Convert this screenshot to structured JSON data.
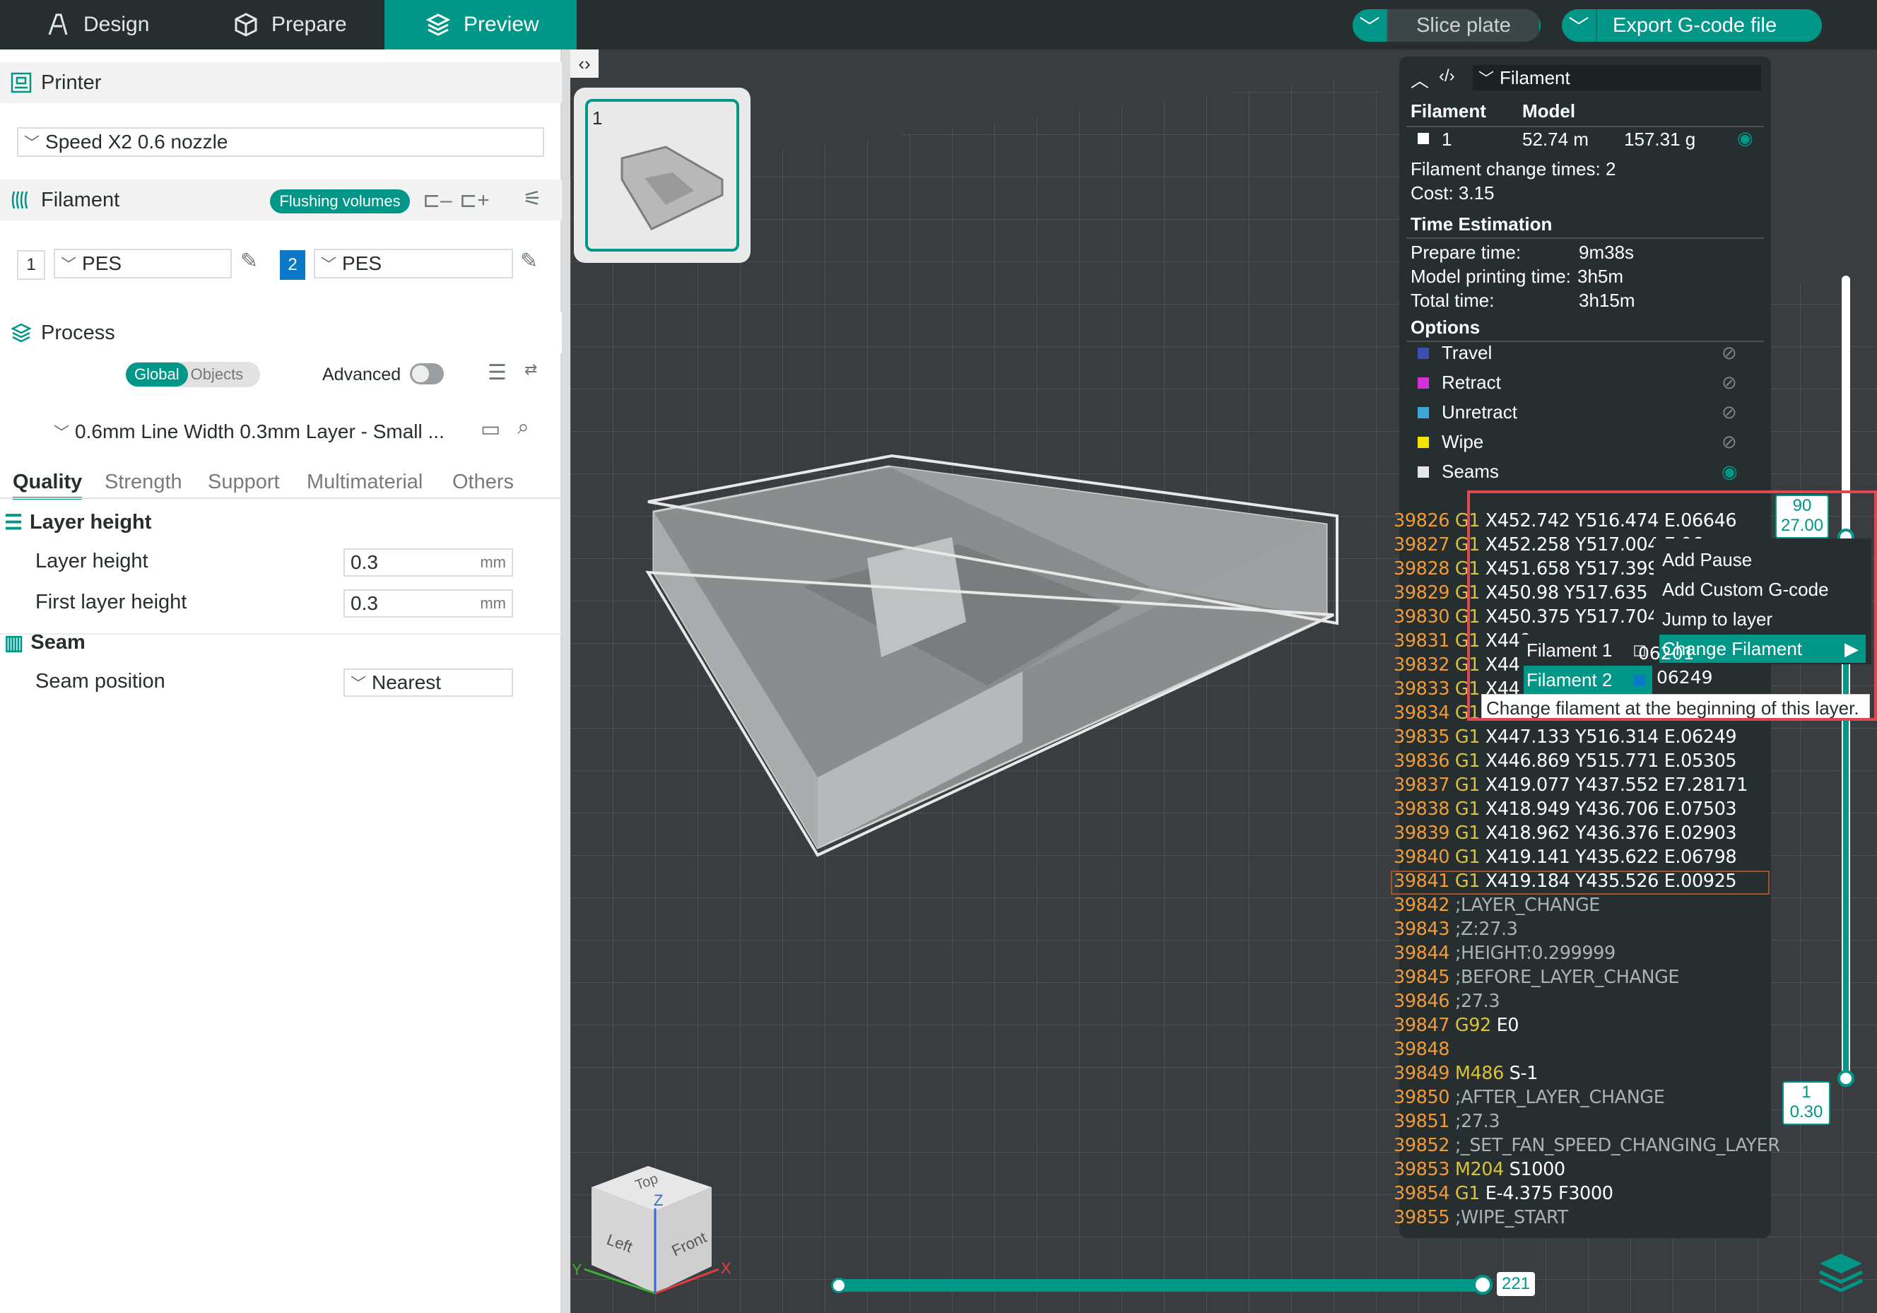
{
  "topbar": {
    "tabs": [
      {
        "label": "Design",
        "icon": "design-icon"
      },
      {
        "label": "Prepare",
        "icon": "cube-icon"
      },
      {
        "label": "Preview",
        "icon": "layers-icon",
        "active": true
      }
    ],
    "slice_label": "Slice plate",
    "export_label": "Export G-code file"
  },
  "sidebar": {
    "printer_title": "Printer",
    "printer_preset": "Speed X2 0.6 nozzle",
    "filament_title": "Filament",
    "flushing_label": "Flushing volumes",
    "filaments": [
      {
        "index": "1",
        "name": "PES"
      },
      {
        "index": "2",
        "name": "PES"
      }
    ],
    "process_title": "Process",
    "process_global": "Global",
    "process_objects": "Objects",
    "advanced_label": "Advanced",
    "process_preset": "0.6mm Line Width 0.3mm Layer - Small ...",
    "subtabs": [
      "Quality",
      "Strength",
      "Support",
      "Multimaterial",
      "Others"
    ],
    "groups": {
      "layer_height_title": "Layer height",
      "layer_height_label": "Layer height",
      "layer_height_value": "0.3",
      "first_layer_label": "First layer height",
      "first_layer_value": "0.3",
      "unit": "mm",
      "seam_title": "Seam",
      "seam_position_label": "Seam position",
      "seam_position_value": "Nearest"
    }
  },
  "viewport": {
    "plate_number": "1",
    "cube": {
      "top": "Top",
      "left": "Left",
      "front": "Front",
      "x": "X",
      "y": "Y",
      "z": "Z"
    },
    "h_slider_value": "221",
    "v_slider_top": {
      "layer": "90",
      "height": "27.00"
    },
    "v_slider_bottom": {
      "layer": "1",
      "height": "0.30"
    },
    "v_slider_fraction": 0.33
  },
  "legend": {
    "view_select": "Filament",
    "col_filament": "Filament",
    "col_model": "Model",
    "row_index": "1",
    "row_length": "52.74 m",
    "row_weight": "157.31 g",
    "change_times": "Filament change times: 2",
    "cost": "Cost: 3.15",
    "time_title": "Time Estimation",
    "prepare_label": "Prepare time:",
    "prepare_value": "9m38s",
    "model_label": "Model printing time:",
    "model_value": "3h5m",
    "total_label": "Total time:",
    "total_value": "3h15m",
    "options_title": "Options",
    "options": [
      {
        "label": "Travel",
        "color": "#3a4fb0"
      },
      {
        "label": "Retract",
        "color": "#d62fd6"
      },
      {
        "label": "Unretract",
        "color": "#3ca7d8"
      },
      {
        "label": "Wipe",
        "color": "#f2e600"
      },
      {
        "label": "Seams",
        "color": "#e6e6e6"
      }
    ]
  },
  "gcode": [
    {
      "n": "39826",
      "c": "G1",
      "a": "X452.742 Y516.474 E.06646"
    },
    {
      "n": "39827",
      "c": "G1",
      "a": "X452.258 Y517.004 E.06"
    },
    {
      "n": "39828",
      "c": "G1",
      "a": "X451.658 Y517.399 E.0"
    },
    {
      "n": "39829",
      "c": "G1",
      "a": "X450.98 Y517.635 E.0"
    },
    {
      "n": "39830",
      "c": "G1",
      "a": "X450.375 Y517.704 E.0"
    },
    {
      "n": "39831",
      "c": "G1",
      "a": "X449"
    },
    {
      "n": "39832",
      "c": "G1",
      "a": "X448"
    },
    {
      "n": "39833",
      "c": "G1",
      "a": "X448"
    },
    {
      "n": "39834",
      "c": "G1",
      "a": ""
    },
    {
      "n": "39835",
      "c": "G1",
      "a": "X447.133 Y516.314 E.06249"
    },
    {
      "n": "39836",
      "c": "G1",
      "a": "X446.869 Y515.771 E.05305"
    },
    {
      "n": "39837",
      "c": "G1",
      "a": "X419.077 Y437.552 E7.28171"
    },
    {
      "n": "39838",
      "c": "G1",
      "a": "X418.949 Y436.706 E.07503"
    },
    {
      "n": "39839",
      "c": "G1",
      "a": "X418.962 Y436.376 E.02903"
    },
    {
      "n": "39840",
      "c": "G1",
      "a": "X419.141 Y435.622 E.06798"
    },
    {
      "n": "39841",
      "c": "G1",
      "a": "X419.184 Y435.526 E.00925"
    },
    {
      "n": "39842",
      "c": "",
      "a": ";LAYER_CHANGE"
    },
    {
      "n": "39843",
      "c": "",
      "a": ";Z:27.3"
    },
    {
      "n": "39844",
      "c": "",
      "a": ";HEIGHT:0.299999"
    },
    {
      "n": "39845",
      "c": "",
      "a": ";BEFORE_LAYER_CHANGE"
    },
    {
      "n": "39846",
      "c": "",
      "a": ";27.3"
    },
    {
      "n": "39847",
      "c": "G92",
      "a": "E0"
    },
    {
      "n": "39848",
      "c": "",
      "a": ""
    },
    {
      "n": "39849",
      "c": "M486",
      "a": "S-1"
    },
    {
      "n": "39850",
      "c": "",
      "a": ";AFTER_LAYER_CHANGE"
    },
    {
      "n": "39851",
      "c": "",
      "a": ";27.3"
    },
    {
      "n": "39852",
      "c": "",
      "a": ";_SET_FAN_SPEED_CHANGING_LAYER"
    },
    {
      "n": "39853",
      "c": "M204",
      "a": "S1000"
    },
    {
      "n": "39854",
      "c": "G1",
      "a": "E-4.375 F3000"
    },
    {
      "n": "39855",
      "c": "",
      "a": ";WIPE_START"
    }
  ],
  "gcode_peek": {
    "l32": "06249",
    "l31": "06201"
  },
  "context_menu": {
    "items": [
      "Add Pause",
      "Add Custom G-code",
      "Jump to layer",
      "Change Filament"
    ],
    "submenu": [
      "Filament 1",
      "Filament 2"
    ],
    "tooltip": "Change filament at the beginning of this layer."
  },
  "colors": {
    "accent": "#009688",
    "highlight": "#e0484f",
    "filament2": "#0b78c8"
  }
}
